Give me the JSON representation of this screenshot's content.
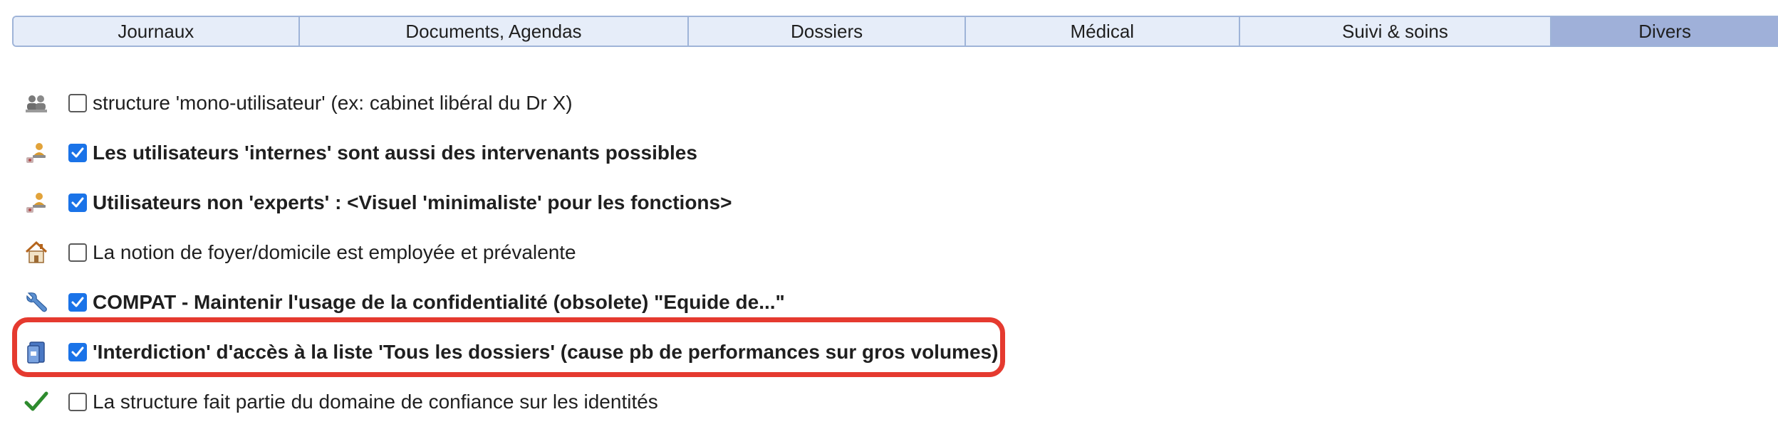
{
  "tabs": [
    {
      "label": "Journaux",
      "active": false
    },
    {
      "label": "Documents, Agendas",
      "active": false
    },
    {
      "label": "Dossiers",
      "active": false
    },
    {
      "label": "Médical",
      "active": false
    },
    {
      "label": "Suivi & soins",
      "active": false
    },
    {
      "label": "Divers",
      "active": true
    }
  ],
  "options": [
    {
      "icon": "users-group-icon",
      "checked": false,
      "bold": false,
      "label": "structure 'mono-utilisateur' (ex: cabinet libéral du Dr X)"
    },
    {
      "icon": "user-stamp-icon",
      "checked": true,
      "bold": true,
      "label": "Les utilisateurs 'internes' sont aussi des intervenants possibles"
    },
    {
      "icon": "user-stamp-icon",
      "checked": true,
      "bold": true,
      "label": "Utilisateurs non 'experts' : <Visuel 'minimaliste' pour les fonctions>"
    },
    {
      "icon": "house-icon",
      "checked": false,
      "bold": false,
      "label": "La notion de foyer/domicile est employée et prévalente"
    },
    {
      "icon": "wrench-icon",
      "checked": true,
      "bold": true,
      "label": "COMPAT - Maintenir l'usage de la confidentialité (obsolete) \"Equide de...\""
    },
    {
      "icon": "folder-blocked-icon",
      "checked": true,
      "bold": true,
      "label": "'Interdiction' d'accès à la liste 'Tous les dossiers' (cause pb de performances sur gros volumes)"
    },
    {
      "icon": "green-check-icon",
      "checked": false,
      "bold": false,
      "label": "La structure fait partie du domaine de confiance sur les identités"
    }
  ],
  "colors": {
    "tab_bg": "#e6edf9",
    "tab_active_bg": "#9fb0d9",
    "checkbox_checked": "#1a73e8",
    "highlight_border": "#e53a2f"
  }
}
